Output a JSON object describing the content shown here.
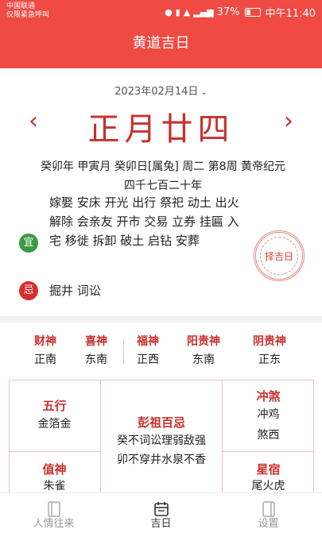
{
  "status_bar": {
    "carrier_line1": "中国联通",
    "carrier_line2": "仅限紧急呼叫",
    "battery": "37%",
    "battery_level": 0.37,
    "time": "中午11:40"
  },
  "app_bar": {
    "title": "黄道吉日"
  },
  "date_header": {
    "gregorian_date": "2023年02月14日",
    "lunar_day": "正月廿四",
    "ganzhi": "癸卯年 甲寅月 癸卯日[属兔] 周二 第8周 黄帝纪元四千七百二十年"
  },
  "yi": {
    "badge": "宜",
    "text": "嫁娶 安床 开光 出行 祭祀 动土 出火 解除 会亲友 开市 交易 立券 挂匾 入宅 移徙 拆卸 破土 启钻 安葬"
  },
  "ji": {
    "badge": "忌",
    "text": "掘井 词讼"
  },
  "stamp": {
    "label": "择吉日"
  },
  "gods": [
    {
      "title": "财神",
      "value": "正南"
    },
    {
      "title": "喜神",
      "value": "东南"
    },
    {
      "title": "福神",
      "value": "正西"
    },
    {
      "title": "阳贵神",
      "value": "东南"
    },
    {
      "title": "阴贵神",
      "value": "正东"
    }
  ],
  "grid": {
    "wuxing": {
      "title": "五行",
      "value": "金箔金"
    },
    "pengzu": {
      "title": "彭祖百忌",
      "line1": "癸不词讼理弱敌强",
      "line2": "卯不穿井水泉不香"
    },
    "chongsha": {
      "title": "冲煞",
      "line1": "冲鸡",
      "line2": "煞西"
    },
    "zhishen": {
      "title": "值神",
      "value": "朱雀"
    },
    "xingxiu": {
      "title": "星宿",
      "value": "尾火虎"
    }
  },
  "bottom_nav": {
    "tabs": [
      {
        "label": "人情往来",
        "icon": "book-icon",
        "active": false
      },
      {
        "label": "吉日",
        "icon": "calendar-icon",
        "active": true
      },
      {
        "label": "设置",
        "icon": "settings-book-icon",
        "active": false
      }
    ]
  },
  "colors": {
    "primary": "#ef4a43",
    "accent_red": "#c9302c",
    "yi_green": "#3a9a44",
    "ji_red": "#d92c2c"
  }
}
